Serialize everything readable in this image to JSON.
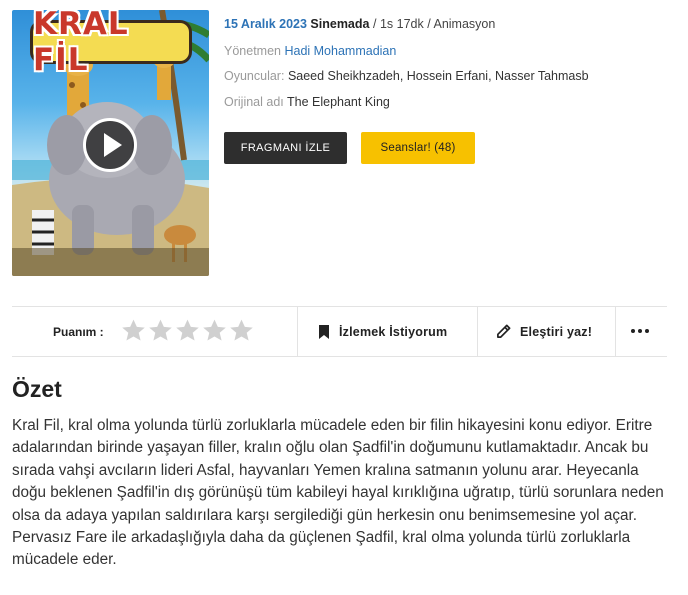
{
  "movie": {
    "poster_title": "KRAL FİL",
    "release_date": "15 Aralık 2023",
    "release_location": "Sinemada",
    "duration": "1s 17dk",
    "genre": "Animasyon",
    "separator": "/",
    "director_label": "Yönetmen",
    "director": "Hadi Mohammadian",
    "cast_label": "Oyuncular:",
    "cast": "Saeed Sheikhzadeh, Hossein Erfani, Nasser Tahmasb",
    "original_title_label": "Orijinal adı",
    "original_title": "The Elephant King"
  },
  "buttons": {
    "trailer": "FRAGMANI İZLE",
    "sessions": "Seanslar! (48)"
  },
  "actions": {
    "rating_label": "Puanım :",
    "rating_stars_total": 5,
    "rating_value": 0,
    "watchlist": "İzlemek İstiyorum",
    "review": "Eleştiri yaz!"
  },
  "summary": {
    "title": "Özet",
    "text": "Kral Fil, kral olma yolunda türlü zorluklarla mücadele eden bir filin hikayesini konu ediyor. Eritre adalarından birinde yaşayan filler, kralın oğlu olan Şadfil'in doğumunu kutlamaktadır. Ancak bu sırada vahşi avcıların lideri Asfal, hayvanları Yemen kralına satmanın yolunu arar. Heyecanla doğu beklenen Şadfil'in dış görünüşü tüm kabileyi hayal kırıklığına uğratıp, türlü sorunlara neden olsa da adaya yapılan saldırılara karşı sergilediği gün herkesin onu benimsemesine yol açar. Pervasız Fare ile arkadaşlığıyla daha da güçlenen Şadfil, kral olma yolunda türlü zorluklarla mücadele eder."
  },
  "colors": {
    "accent_blue": "#2d73b6",
    "trailer_bg": "#2e2e2e",
    "sessions_bg": "#f7c100",
    "star_empty": "#d0d0d0"
  },
  "icons": [
    "play-icon",
    "star-icon",
    "bookmark-icon",
    "pencil-icon",
    "more-icon"
  ]
}
